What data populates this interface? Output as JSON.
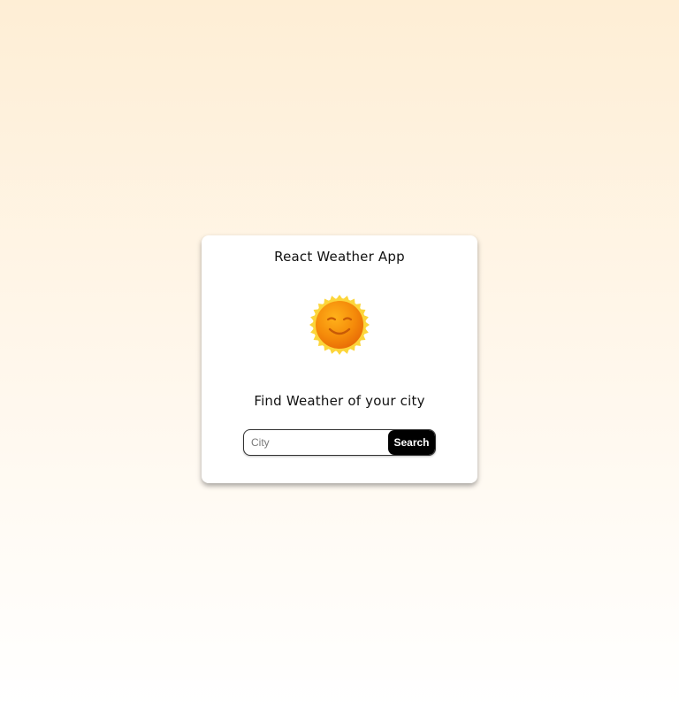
{
  "app": {
    "title": "React Weather App",
    "subtitle": "Find Weather of your city",
    "icon": "smiling-sun-icon"
  },
  "search": {
    "placeholder": "City",
    "value": "",
    "button_label": "Search"
  },
  "colors": {
    "background_top": "#feeed5",
    "background_bottom": "#ffffff",
    "card": "#ffffff",
    "button": "#000000",
    "sun_outer": "#fcc419",
    "sun_inner": "#f08c00"
  }
}
